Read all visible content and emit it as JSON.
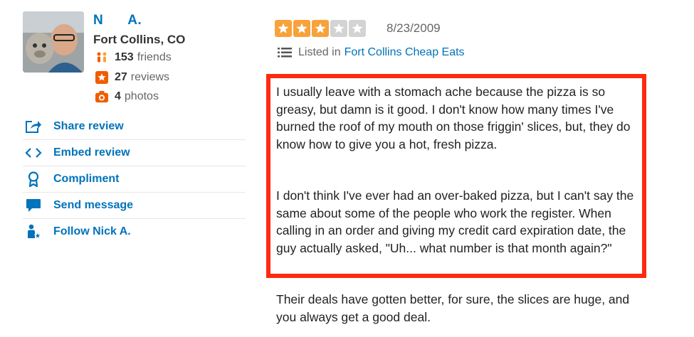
{
  "user": {
    "name": "N      A.",
    "location": "Fort Collins, CO",
    "friends_count": "153",
    "friends_label": "friends",
    "reviews_count": "27",
    "reviews_label": "reviews",
    "photos_count": "4",
    "photos_label": "photos"
  },
  "actions": [
    {
      "label": "Share review",
      "icon": "share-icon"
    },
    {
      "label": "Embed review",
      "icon": "embed-icon"
    },
    {
      "label": "Compliment",
      "icon": "award-icon"
    },
    {
      "label": "Send message",
      "icon": "message-icon"
    },
    {
      "label": "Follow Nick A.",
      "icon": "follow-icon"
    }
  ],
  "review": {
    "rating": 3,
    "max_rating": 5,
    "date": "8/23/2009",
    "listed_prefix": "Listed in",
    "listed_link": "Fort Collins Cheap Eats",
    "paragraphs": [
      "I usually leave with a stomach ache because the pizza is so greasy, but damn is it good.  I don't know how many times I've burned the roof of my mouth on those friggin' slices, but, they do know how to give you a hot, fresh pizza.",
      "I don't think I've ever had an over-baked pizza, but I can't say the same about some of the people who work the register.  When calling in an order and giving my credit card expiration date, the guy actually asked, \"Uh... what number is that month again?\"",
      "Their deals have gotten better, for sure, the slices are huge, and you always get a good deal."
    ]
  },
  "colors": {
    "link": "#0073bb",
    "star_on": "#f8a23a",
    "star_off": "#d3d3d3",
    "highlight": "#ff2a12"
  }
}
